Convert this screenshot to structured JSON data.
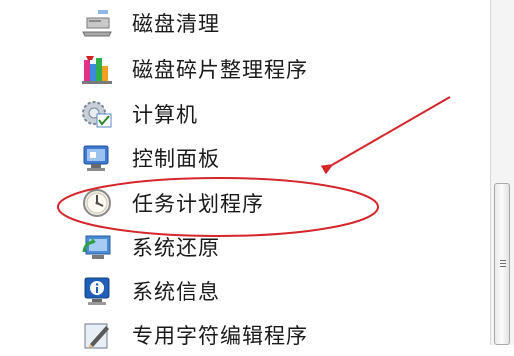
{
  "menu": {
    "items": [
      {
        "label": "磁盘清理",
        "icon": "disk-cleanup-icon"
      },
      {
        "label": "磁盘碎片整理程序",
        "icon": "disk-defragmenter-icon"
      },
      {
        "label": "计算机",
        "icon": "computer-icon"
      },
      {
        "label": "控制面板",
        "icon": "control-panel-icon"
      },
      {
        "label": "任务计划程序",
        "icon": "task-scheduler-icon"
      },
      {
        "label": "系统还原",
        "icon": "system-restore-icon"
      },
      {
        "label": "系统信息",
        "icon": "system-information-icon"
      },
      {
        "label": "专用字符编辑程序",
        "icon": "private-character-editor-icon"
      }
    ]
  },
  "annotation": {
    "stroke_color": "#d4262b"
  },
  "colors": {
    "text": "#1a1a1a",
    "background": "#ffffff",
    "scrollbar_track": "#f4f4f4"
  }
}
